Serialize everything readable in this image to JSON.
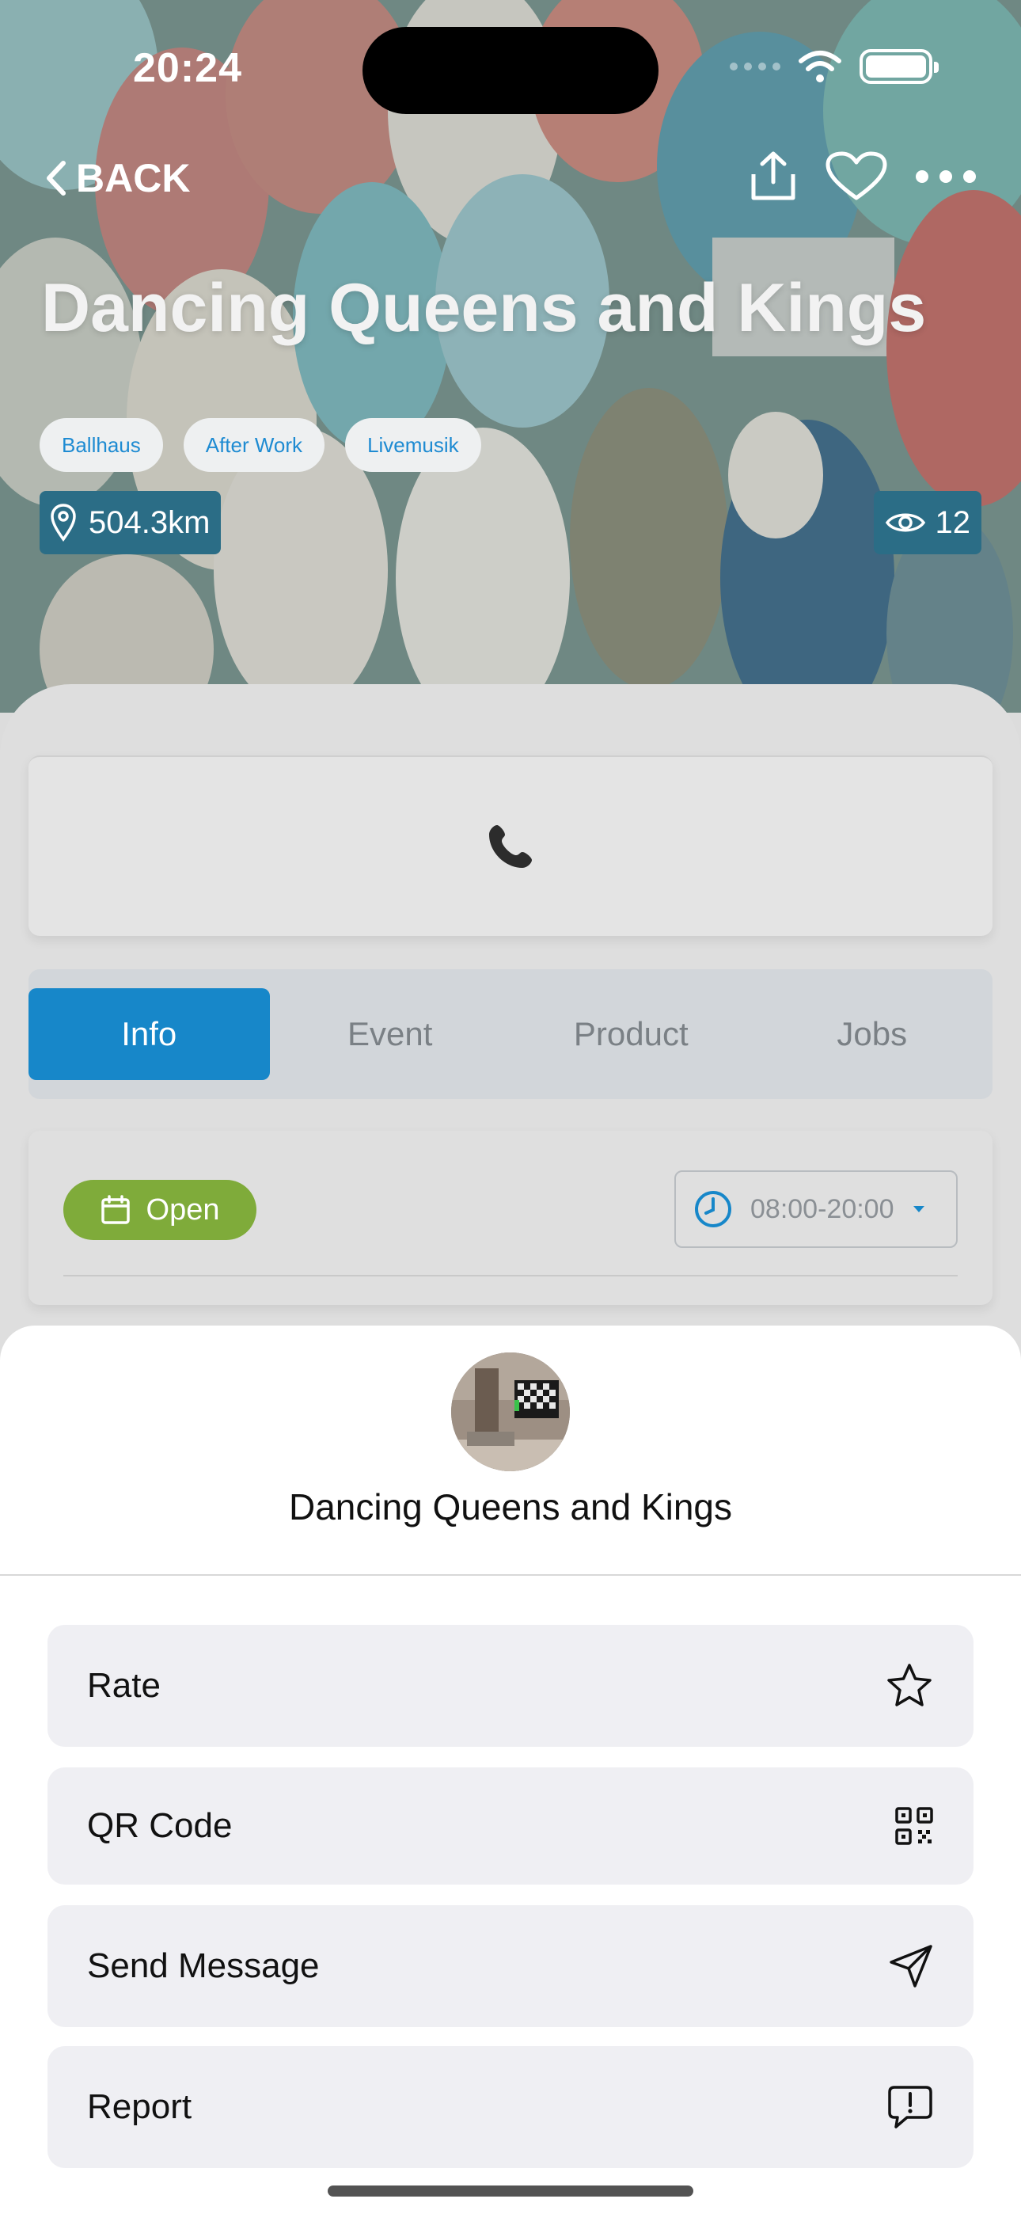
{
  "status_bar": {
    "time": "20:24"
  },
  "nav": {
    "back_label": "BACK"
  },
  "venue": {
    "title": "Dancing Queens and Kings",
    "tags": [
      "Ballhaus",
      "After Work",
      "Livemusik"
    ],
    "distance": "504.3km",
    "views": "12"
  },
  "tabs": [
    {
      "label": "Info",
      "active": true
    },
    {
      "label": "Event",
      "active": false
    },
    {
      "label": "Product",
      "active": false
    },
    {
      "label": "Jobs",
      "active": false
    }
  ],
  "hours": {
    "status": "Open",
    "range": "08:00-20:00"
  },
  "action_sheet": {
    "title": "Dancing Queens and Kings",
    "actions": [
      {
        "label": "Rate",
        "icon": "star-icon"
      },
      {
        "label": "QR Code",
        "icon": "qr-code-icon"
      },
      {
        "label": "Send Message",
        "icon": "send-icon"
      },
      {
        "label": "Report",
        "icon": "report-icon"
      }
    ]
  },
  "colors": {
    "accent": "#1787c9",
    "open_green": "#7fab3a",
    "tag_text": "#1e8bd2",
    "badge_bg": "#2b6d86"
  }
}
